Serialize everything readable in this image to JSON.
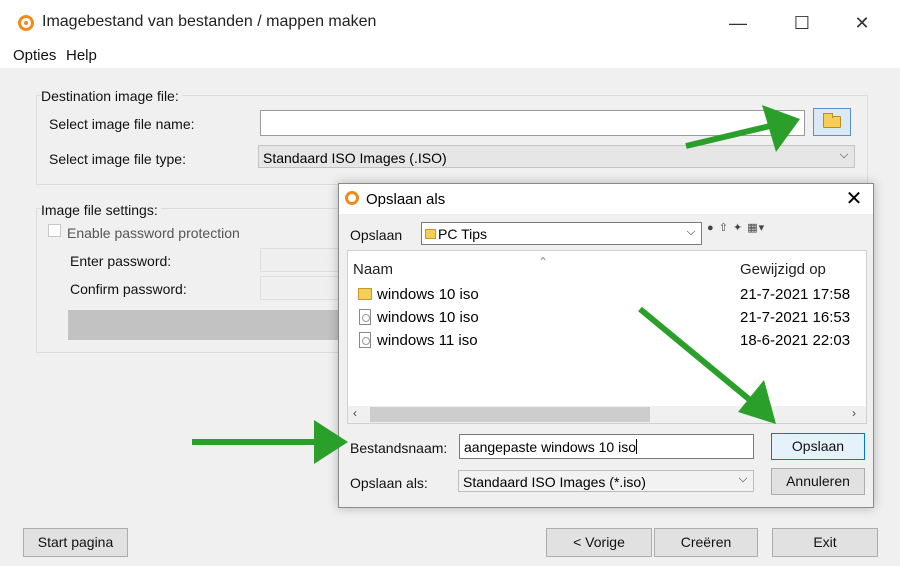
{
  "window": {
    "title": "Imagebestand van bestanden / mappen maken",
    "min": "—",
    "max": "☐",
    "close": "✕"
  },
  "menu": {
    "items": [
      "Opties",
      "Help"
    ]
  },
  "destination": {
    "group_label": "Destination image file:",
    "name_label": "Select image file name:",
    "name_value": "",
    "type_label": "Select image file type:",
    "type_value": "Standaard ISO Images (.ISO)"
  },
  "settings": {
    "group_label": "Image file settings:",
    "password_checkbox_label": "Enable password protection",
    "enter_password_label": "Enter password:",
    "confirm_password_label": "Confirm password:"
  },
  "bottom_buttons": {
    "start": "Start pagina",
    "prev": "< Vorige",
    "create": "Creëren",
    "exit": "Exit"
  },
  "dialog": {
    "title": "Opslaan als",
    "close": "✕",
    "location_label": "Opslaan",
    "location_value": "PC Tips",
    "columns": {
      "name": "Naam",
      "date": "Gewijzigd op"
    },
    "files": [
      {
        "name": "windows 10 iso",
        "date": "21-7-2021 17:58",
        "type": "folder"
      },
      {
        "name": "windows 10 iso",
        "date": "21-7-2021 16:53",
        "type": "file"
      },
      {
        "name": "windows 11 iso",
        "date": "18-6-2021 22:03",
        "type": "file"
      }
    ],
    "filename_label": "Bestandsnaam:",
    "filename_value": "aangepaste windows 10 iso",
    "savetype_label": "Opslaan als:",
    "savetype_value": "Standaard ISO Images (*.iso)",
    "save_button": "Opslaan",
    "cancel_button": "Annuleren"
  },
  "colors": {
    "accent": "#0078d7",
    "arrow": "#2aa02a",
    "app_icon": "#f08c1e"
  },
  "icons": [
    "app-logo-icon",
    "folder-icon",
    "file-icon",
    "chevron-down-icon",
    "close-icon",
    "minimize-icon",
    "maximize-icon"
  ]
}
